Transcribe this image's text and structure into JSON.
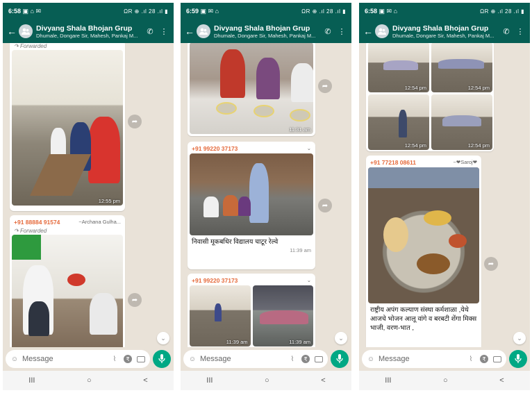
{
  "screens": [
    {
      "status": {
        "time": "6:58",
        "icons": "▣ ⌂ ✉",
        "right": "ΩR ⊕ .ıl 28 .ıl ▮"
      },
      "header": {
        "title": "Divyang Shala Bhojan Grup",
        "members": "Dhumale, Dongare Sir, Mahesh, Pankaj M..."
      },
      "messages": [
        {
          "forwarded": "Forwarded",
          "time": "12:55 pm"
        },
        {
          "sender_number": "+91 88884 91574",
          "sender_alias": "~Archana Gulha...",
          "forwarded": "Forwarded"
        }
      ],
      "input_placeholder": "Message"
    },
    {
      "status": {
        "time": "6:59",
        "icons": "▣ ✉ ⌂",
        "right": "ΩR ⊕ .ıl 28 .ıl ▮"
      },
      "header": {
        "title": "Divyang Shala Bhojan Grup",
        "members": "Dhumale, Dongare Sir, Mahesh, Pankaj M..."
      },
      "messages": [
        {
          "time": "11:31 am"
        },
        {
          "sender_number": "+91 99220 37173",
          "caption": "निवासी मूकबधिर विद्यालय चाटूर रेल्वे",
          "time": "11:39 am"
        },
        {
          "sender_number": "+91 99220 37173",
          "time_left": "11:39 am",
          "time_right": "11:39 am"
        }
      ],
      "input_placeholder": "Message"
    },
    {
      "status": {
        "time": "6:58",
        "icons": "▣ ✉ ⌂",
        "right": "ΩR ⊕ .ıl 28 .ıl ▮"
      },
      "header": {
        "title": "Divyang Shala Bhojan Grup",
        "members": "Dhumale, Dongare Sir, Mahesh, Pankaj M..."
      },
      "messages": [
        {
          "grid_times": [
            "12:54 pm",
            "12:54 pm",
            "12:54 pm",
            "12:54 pm"
          ]
        },
        {
          "sender_number": "+91 77218 08611",
          "sender_alias": "~❤Saroj❤",
          "caption": "राष्ट्रीय अपंग कल्याण संस्था कर्मशाळा ,येथे आजचे भोजन आलू वांगे व बरबटी शेंगा मिक्स भाजी, वरण-भात ,"
        }
      ],
      "input_placeholder": "Message"
    }
  ],
  "nav": {
    "recents": "III",
    "home": "○",
    "back": "<"
  },
  "colors": {
    "header": "#075e54",
    "accent": "#00a884",
    "chat_bg": "#e9e2d8",
    "sender": "#e5693a"
  }
}
